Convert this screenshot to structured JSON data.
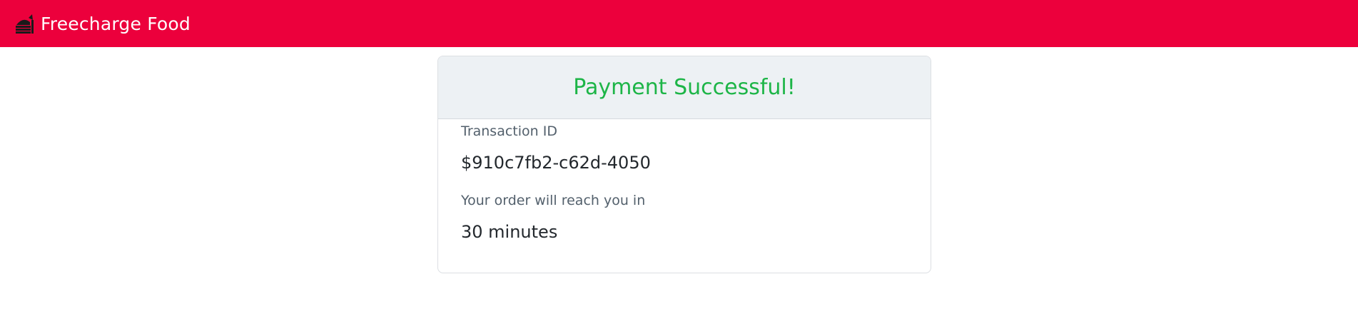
{
  "navbar": {
    "brand_icon": "food-plate-icon",
    "brand_text": "Freecharge Food",
    "background_color": "#ec003c"
  },
  "payment": {
    "title": "Payment Successful!",
    "title_color": "#1db547",
    "transaction_label": "Transaction ID",
    "transaction_id": "$910c7fb2-c62d-4050",
    "eta_label": "Your order will reach you in",
    "eta_value": "30 minutes"
  }
}
